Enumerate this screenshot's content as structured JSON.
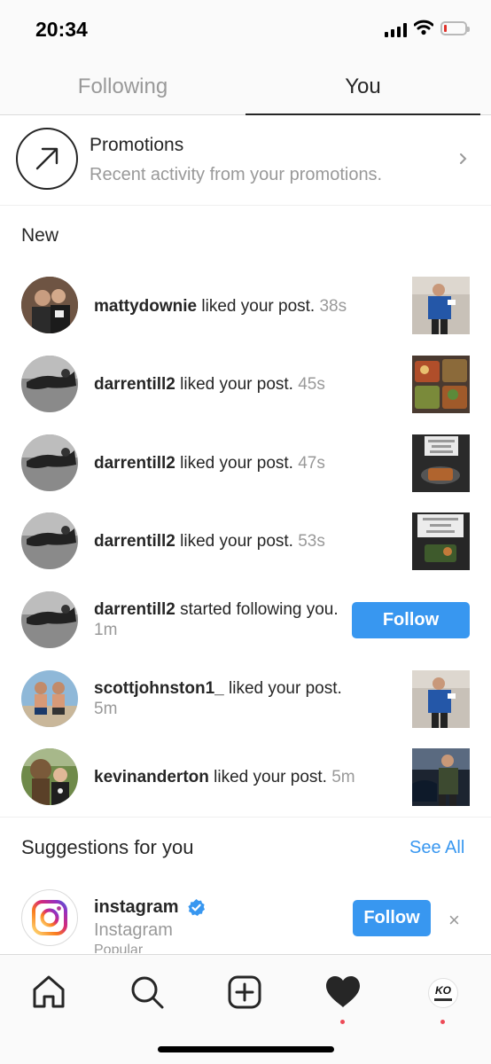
{
  "status": {
    "time": "20:34"
  },
  "tabs": [
    {
      "label": "Following"
    },
    {
      "label": "You"
    }
  ],
  "promotions": {
    "title": "Promotions",
    "subtitle": "Recent activity from your promotions."
  },
  "section_new": "New",
  "activity": [
    {
      "user": "mattydownie",
      "action": " liked your post.",
      "time": "38s"
    },
    {
      "user": "darrentill2",
      "action": " liked your post.",
      "time": "45s"
    },
    {
      "user": "darrentill2",
      "action": " liked your post.",
      "time": "47s"
    },
    {
      "user": "darrentill2",
      "action": " liked your post.",
      "time": "53s"
    },
    {
      "user": "darrentill2",
      "action": " started following you.",
      "time": "1m",
      "button": "Follow"
    },
    {
      "user": "scottjohnston1_",
      "action": " liked your post.",
      "time": "5m"
    },
    {
      "user": "kevinanderton",
      "action": " liked your post.",
      "time": "5m"
    }
  ],
  "suggestions": {
    "title": "Suggestions for you",
    "see_all": "See All",
    "items": [
      {
        "username": "instagram",
        "full_name": "Instagram",
        "note": "Popular",
        "button": "Follow",
        "dismiss": "×"
      }
    ]
  },
  "nav": [
    "home-icon",
    "search-icon",
    "new-post-icon",
    "activity-heart-icon",
    "profile-avatar-icon"
  ],
  "profile_avatar_text": "KO",
  "colors": {
    "accent": "#3897f0",
    "notification": "#ed4956",
    "muted": "#999999"
  }
}
